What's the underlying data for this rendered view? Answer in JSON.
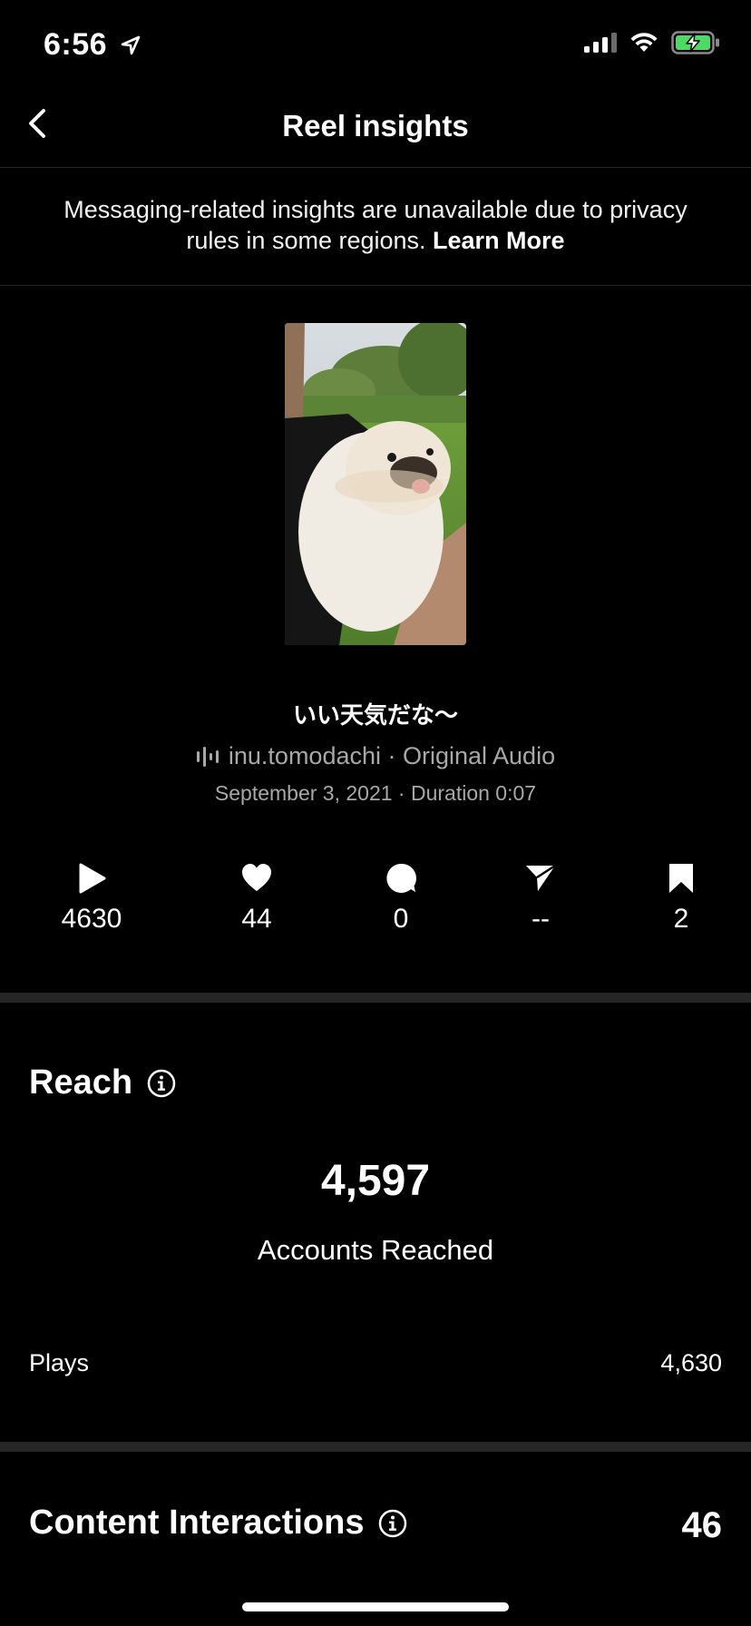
{
  "status_bar": {
    "time": "6:56"
  },
  "header": {
    "title": "Reel insights"
  },
  "notice": {
    "text": "Messaging-related insights are unavailable due to privacy rules in some regions. ",
    "link": "Learn More"
  },
  "reel": {
    "caption": "いい天気だな〜",
    "audio": "inu.tomodachi · Original Audio",
    "meta": "September 3, 2021 · Duration 0:07"
  },
  "stats": {
    "plays": "4630",
    "likes": "44",
    "comments": "0",
    "shares": "--",
    "saves": "2"
  },
  "reach": {
    "title": "Reach",
    "accounts_reached": "4,597",
    "accounts_reached_label": "Accounts Reached",
    "plays_label": "Plays",
    "plays_value": "4,630"
  },
  "content_interactions": {
    "title": "Content Interactions",
    "value": "46"
  }
}
